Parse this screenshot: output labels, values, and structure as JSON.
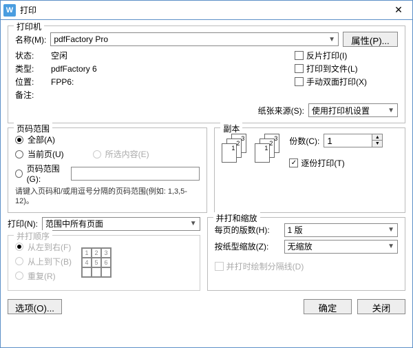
{
  "window": {
    "title": "打印",
    "icon": "W"
  },
  "printer": {
    "section": "打印机",
    "name_label": "名称(M):",
    "name_value": "pdfFactory Pro",
    "properties_btn": "属性(P)...",
    "status_label": "状态:",
    "status_value": "空闲",
    "type_label": "类型:",
    "type_value": "pdfFactory 6",
    "location_label": "位置:",
    "location_value": "FPP6:",
    "remark_label": "备注:",
    "remark_value": "",
    "reverse_print": "反片打印(I)",
    "print_to_file": "打印到文件(L)",
    "manual_duplex": "手动双面打印(X)",
    "paper_source_label": "纸张来源(S):",
    "paper_source_value": "使用打印机设置"
  },
  "page_range": {
    "section": "页码范围",
    "all": "全部(A)",
    "current": "当前页(U)",
    "selection": "所选内容(E)",
    "range_label": "页码范围(G):",
    "hint": "请键入页码和/或用逗号分隔的页码范围(例如: 1,3,5-12)。"
  },
  "copies": {
    "section": "副本",
    "count_label": "份数(C):",
    "count_value": "1",
    "collate": "逐份打印(T)"
  },
  "print_what": {
    "label": "打印(N):",
    "value": "范围中所有页面"
  },
  "merge_zoom": {
    "section": "并打和缩放",
    "pages_per_label": "每页的版数(H):",
    "pages_per_value": "1 版",
    "scale_label": "按纸型缩放(Z):",
    "scale_value": "无缩放",
    "draw_lines": "并打时绘制分隔线(D)"
  },
  "merge_order": {
    "section": "并打顺序",
    "lr": "从左到右(F)",
    "tb": "从上到下(B)",
    "repeat": "重复(R)"
  },
  "footer": {
    "options": "选项(O)...",
    "ok": "确定",
    "close": "关闭"
  }
}
